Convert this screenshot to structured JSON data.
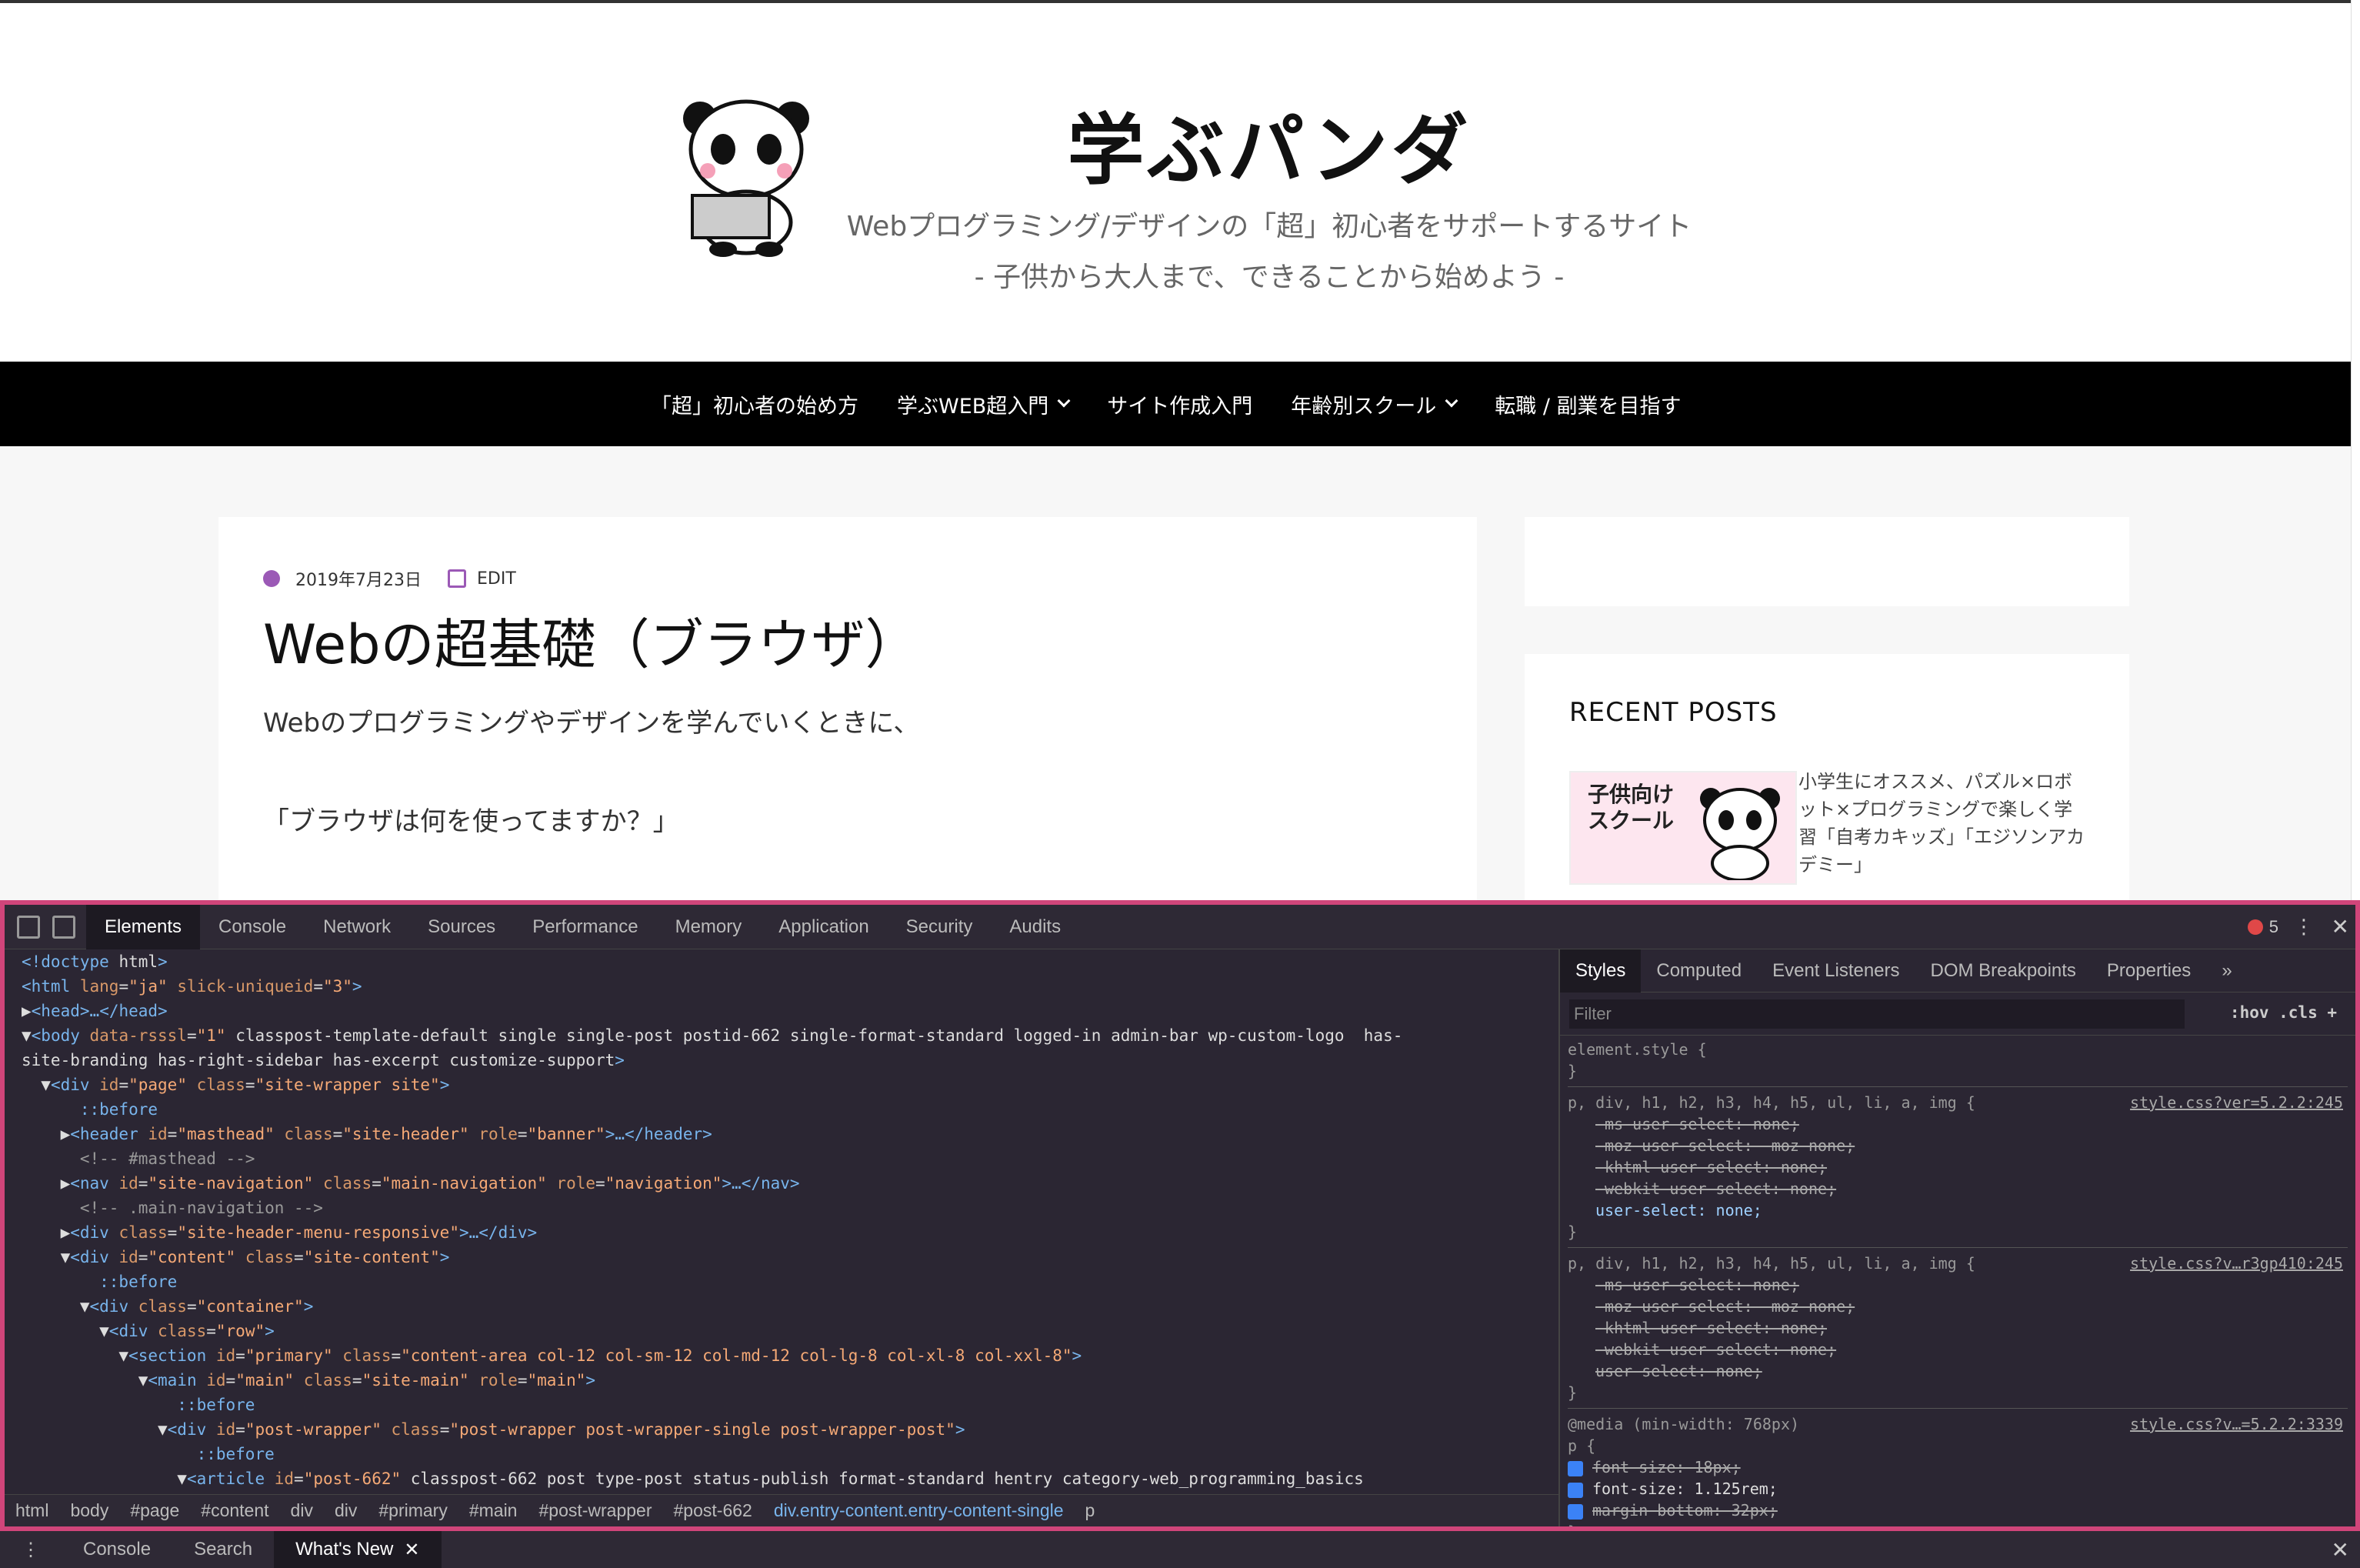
{
  "site": {
    "title": "学ぶパンダ",
    "tagline1": "Webプログラミング/デザインの「超」初心者をサポートするサイト",
    "tagline2": "- 子供から大人まで、できることから始めよう -"
  },
  "nav": [
    {
      "label": "「超」初心者の始め方",
      "dropdown": false
    },
    {
      "label": "学ぶWEB超入門",
      "dropdown": true
    },
    {
      "label": "サイト作成入門",
      "dropdown": false
    },
    {
      "label": "年齢別スクール",
      "dropdown": true
    },
    {
      "label": "転職 / 副業を目指す",
      "dropdown": false
    }
  ],
  "post": {
    "date": "2019年7月23日",
    "edit": "EDIT",
    "title": "Webの超基礎（ブラウザ）",
    "para1": "Webのプログラミングやデザインを学んでいくときに、",
    "para2": "「ブラウザは何を使ってますか？」"
  },
  "sidebar": {
    "recent_title": "RECENT POSTS",
    "thumb_text": "子供向け\nスクール",
    "recent_item": "小学生にオススメ、パズル×ロボット×プログラミングで楽しく学習「自考カキッズ」「エジソンアカデミー」"
  },
  "devtools": {
    "tabs": [
      "Elements",
      "Console",
      "Network",
      "Sources",
      "Performance",
      "Memory",
      "Application",
      "Security",
      "Audits"
    ],
    "active_tab": "Elements",
    "errors": "5",
    "style_tabs": [
      "Styles",
      "Computed",
      "Event Listeners",
      "DOM Breakpoints",
      "Properties",
      "»"
    ],
    "filter_placeholder": "Filter",
    "filter_buttons": ":hov  .cls  +",
    "breadcrumbs": [
      "html",
      "body",
      "#page",
      "#content",
      "div",
      "div",
      "#primary",
      "#main",
      "#post-wrapper",
      "#post-662",
      "div.entry-content.entry-content-single",
      "p"
    ],
    "drawer_tabs": [
      "Console",
      "Search",
      "What's New"
    ],
    "elements_lines": [
      "<!doctype html>",
      "<html lang=\"ja\" slick-uniqueid=\"3\">",
      "▶<head>…</head>",
      "▼<body data-rsssl=\"1\" class=\"post-template-default single single-post postid-662 single-format-standard logged-in admin-bar wp-custom-logo  has-",
      "site-branding has-right-sidebar has-excerpt customize-support\">",
      "  ▼<div id=\"page\" class=\"site-wrapper site\">",
      "      ::before",
      "    ▶<header id=\"masthead\" class=\"site-header\" role=\"banner\">…</header>",
      "      <!-- #masthead -->",
      "    ▶<nav id=\"site-navigation\" class=\"main-navigation\" role=\"navigation\">…</nav>",
      "      <!-- .main-navigation -->",
      "    ▶<div class=\"site-header-menu-responsive\">…</div>",
      "    ▼<div id=\"content\" class=\"site-content\">",
      "        ::before",
      "      ▼<div class=\"container\">",
      "        ▼<div class=\"row\">",
      "          ▼<section id=\"primary\" class=\"content-area col-12 col-sm-12 col-md-12 col-lg-8 col-xl-8 col-xxl-8\">",
      "            ▼<main id=\"main\" class=\"site-main\" role=\"main\">",
      "                ::before",
      "              ▼<div id=\"post-wrapper\" class=\"post-wrapper post-wrapper-single post-wrapper-post\">",
      "                  ::before",
      "                ▼<article id=\"post-662\" class=\"post-662 post type-post status-publish format-standard hentry category-web_programming_basics"
    ],
    "rules": [
      {
        "selector": "element.style {",
        "source": "",
        "decls": []
      },
      {
        "selector": "p, div, h1, h2, h3, h4, h5, ul, li, a, img {",
        "source": "style.css?ver=5.2.2:245",
        "decls": [
          {
            "text": "-ms-user-select: none;",
            "state": "strike"
          },
          {
            "text": "-moz-user-select: -moz-none;",
            "state": "strike"
          },
          {
            "text": "-khtml-user-select: none;",
            "state": "strike"
          },
          {
            "text": "-webkit-user-select: none;",
            "state": "strike"
          },
          {
            "text": "user-select: none;",
            "state": "on"
          }
        ]
      },
      {
        "selector": "p, div, h1, h2, h3, h4, h5, ul, li, a, img {",
        "source": "style.css?v…r3gp410:245",
        "decls": [
          {
            "text": "-ms-user-select: none;",
            "state": "strike"
          },
          {
            "text": "-moz-user-select: -moz-none;",
            "state": "strike"
          },
          {
            "text": "-khtml-user-select: none;",
            "state": "strike"
          },
          {
            "text": "-webkit-user-select: none;",
            "state": "strike"
          },
          {
            "text": "user-select: none;",
            "state": "strike"
          }
        ]
      },
      {
        "selector": "@media (min-width: 768px)\np {",
        "source": "style.css?v…=5.2.2:3339",
        "decls": [
          {
            "text": "font-size: 18px;",
            "state": "strike-check"
          },
          {
            "text": "font-size: 1.125rem;",
            "state": "check"
          },
          {
            "text": "margin-bottom: 32px;",
            "state": "strike-check"
          }
        ]
      }
    ]
  }
}
